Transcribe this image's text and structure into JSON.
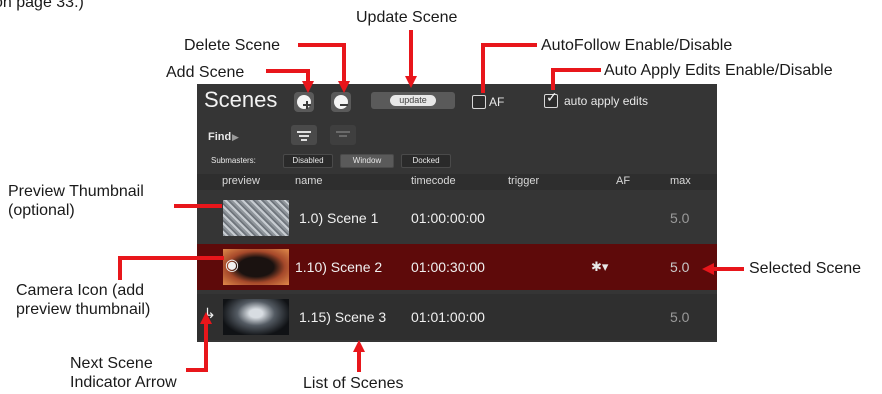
{
  "annotations": {
    "top_partial": "on page 33.)",
    "update_scene": "Update Scene",
    "delete_scene": "Delete Scene",
    "autofollow": "AutoFollow Enable/Disable",
    "auto_apply": "Auto Apply Edits Enable/Disable",
    "add_scene": "Add Scene",
    "preview_thumbnail_1": "Preview Thumbnail",
    "preview_thumbnail_2": "(optional)",
    "camera_icon_1": "Camera Icon (add",
    "camera_icon_2": "preview thumbnail)",
    "selected_scene": "Selected Scene",
    "next_scene_1": "Next Scene",
    "next_scene_2": "Indicator Arrow",
    "list_of_scenes": "List of Scenes"
  },
  "panel": {
    "title": "Scenes",
    "add_icon": "plus-circle-icon",
    "delete_icon": "minus-circle-icon",
    "update_label": "update",
    "af_label": "AF",
    "af_checked": false,
    "auto_apply_label": "auto apply edits",
    "auto_apply_checked": true,
    "find_label": "Find",
    "find_arrow": "▶",
    "filter_icon": "filter-icon",
    "submasters_label": "Submasters:",
    "submaster_modes": [
      "Disabled",
      "Window",
      "Docked"
    ],
    "submaster_selected": "Window",
    "columns": [
      "preview",
      "name",
      "timecode",
      "trigger",
      "AF",
      "max"
    ],
    "rows": [
      {
        "name": "1.0) Scene 1",
        "timecode": "01:00:00:00",
        "trigger": "",
        "max": "5.0",
        "selected": false,
        "next": false
      },
      {
        "name": "1.10) Scene 2",
        "timecode": "01:00:30:00",
        "trigger": "gear-icon",
        "max": "5.0",
        "selected": true,
        "next": false
      },
      {
        "name": "1.15) Scene 3",
        "timecode": "01:01:00:00",
        "trigger": "",
        "max": "5.0",
        "selected": false,
        "next": true
      }
    ],
    "next_arrow": "↳",
    "trigger_glyph": "✱▾",
    "camera_glyph": "◉"
  },
  "colors": {
    "annotation_red": "#e8161b",
    "panel_bg": "#353535",
    "selected_row_bg": "#5e0a0a",
    "row_alt_bg": "#2f2f2f"
  }
}
